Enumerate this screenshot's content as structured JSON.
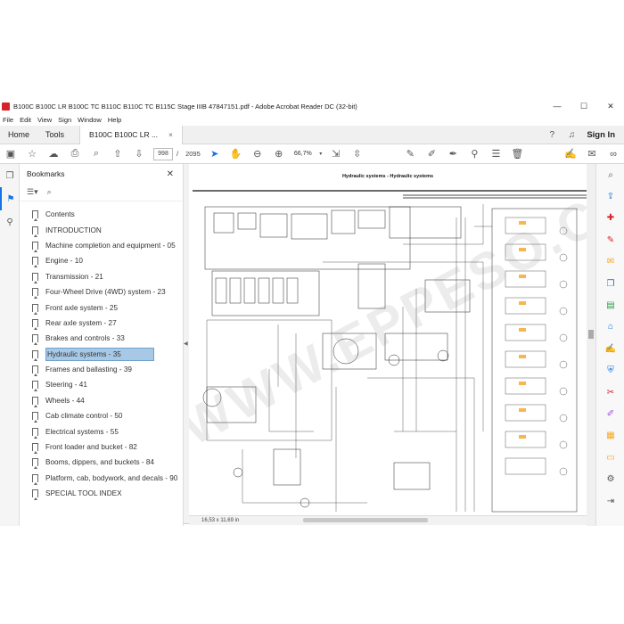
{
  "window": {
    "title": "B100C B100C LR  B100C TC B110C B110C TC B115C Stage IIIB 47847151.pdf - Adobe Acrobat Reader DC (32-bit)",
    "minimize": "—",
    "maximize": "☐",
    "close": "✕"
  },
  "menu": [
    "File",
    "Edit",
    "View",
    "Sign",
    "Window",
    "Help"
  ],
  "tabs": {
    "home": "Home",
    "tools": "Tools",
    "document": "B100C B100C LR ...",
    "doc_close": "×",
    "sign_in": "Sign In"
  },
  "toolbar": {
    "page_current": "998",
    "page_separator": "/",
    "page_total": "2095",
    "zoom": "66,7%"
  },
  "bookmarks": {
    "title": "Bookmarks",
    "close": "✕",
    "items": [
      "Contents",
      "INTRODUCTION",
      "Machine completion and equipment - 05",
      "Engine - 10",
      "Transmission - 21",
      "Four-Wheel Drive (4WD) system - 23",
      "Front axle system - 25",
      "Rear axle system - 27",
      "Brakes and controls - 33",
      "Hydraulic systems - 35",
      "Frames and ballasting - 39",
      "Steering - 41",
      "Wheels - 44",
      "Cab climate control - 50",
      "Electrical systems - 55",
      "Front loader and bucket - 82",
      "Booms, dippers, and buckets - 84",
      "Platform, cab, bodywork, and decals - 90",
      "SPECIAL TOOL INDEX"
    ],
    "selected_index": 9
  },
  "document": {
    "page_header": "Hydraulic systems - Hydraulic systems",
    "page_size": "16,53 x 11,69 in"
  },
  "watermark": "WWW.EPPESO.COM",
  "colors": {
    "accent": "#1473e6",
    "selection": "#a8c9e6",
    "acrobat_red": "#d6222a"
  }
}
